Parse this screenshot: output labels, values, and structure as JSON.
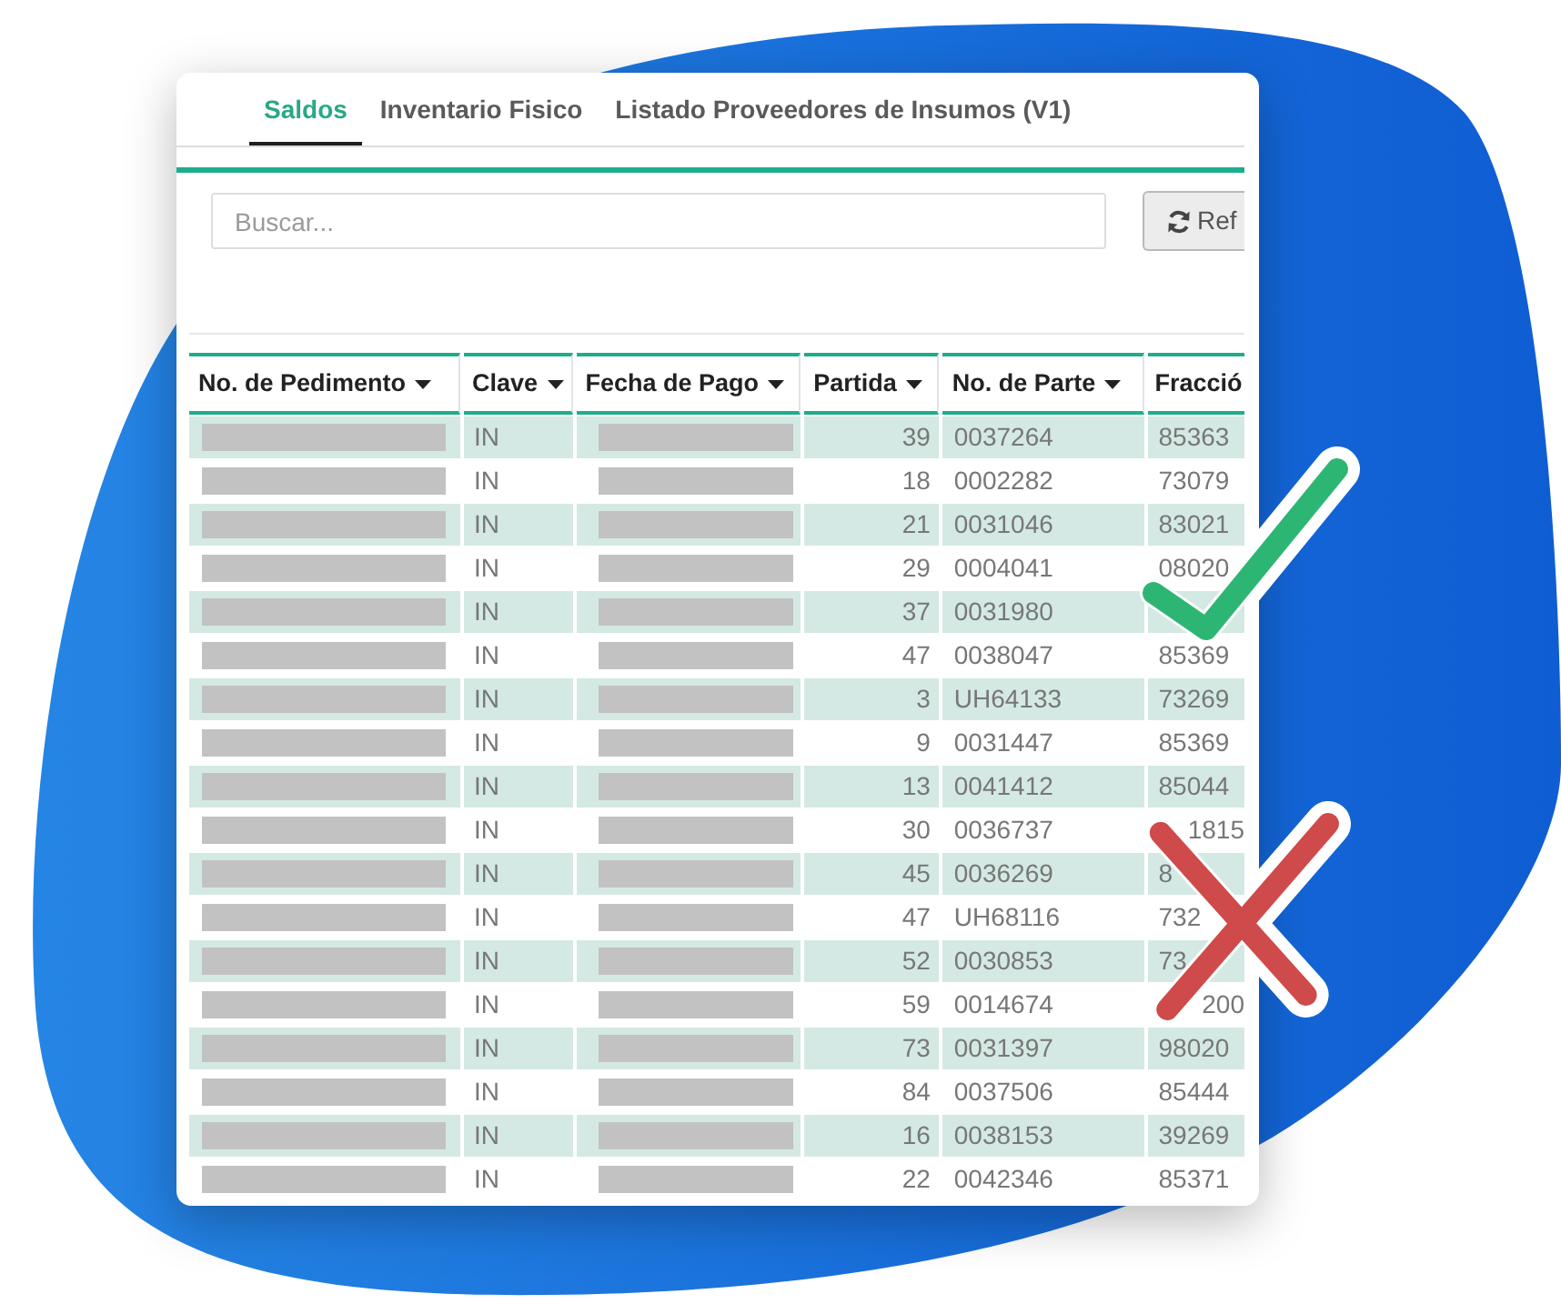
{
  "tabs": [
    {
      "label": "Saldos",
      "selected": true
    },
    {
      "label": "Inventario Fisico",
      "selected": false
    },
    {
      "label": "Listado Proveedores de Insumos (V1)",
      "selected": false
    }
  ],
  "search": {
    "placeholder": "Buscar..."
  },
  "refresh_button": {
    "label": "Ref"
  },
  "table": {
    "columns": [
      {
        "label": "No. de Pedimento",
        "kind": "text"
      },
      {
        "label": "Clave",
        "kind": "text"
      },
      {
        "label": "Fecha de Pago",
        "kind": "text"
      },
      {
        "label": "Partida",
        "kind": "number"
      },
      {
        "label": "No. de Parte",
        "kind": "text"
      },
      {
        "label": "Fracció",
        "kind": "text"
      }
    ],
    "rows": [
      {
        "cells": [
          {
            "redacted": true
          },
          "IN",
          {
            "redacted": true
          },
          "39",
          "0037264",
          "85363"
        ]
      },
      {
        "cells": [
          {
            "redacted": true
          },
          "IN",
          {
            "redacted": true
          },
          "18",
          "0002282",
          "73079"
        ]
      },
      {
        "cells": [
          {
            "redacted": true
          },
          "IN",
          {
            "redacted": true
          },
          "21",
          "0031046",
          "83021"
        ]
      },
      {
        "cells": [
          {
            "redacted": true
          },
          "IN",
          {
            "redacted": true
          },
          "29",
          "0004041",
          "08020"
        ]
      },
      {
        "cells": [
          {
            "redacted": true
          },
          "IN",
          {
            "redacted": true
          },
          "37",
          "0031980"
        ]
      },
      {
        "cells": [
          {
            "redacted": true
          },
          "IN",
          {
            "redacted": true
          },
          "47",
          "0038047",
          "85369"
        ]
      },
      {
        "cells": [
          {
            "redacted": true
          },
          "IN",
          {
            "redacted": true
          },
          "3",
          "UH64133",
          "73269"
        ]
      },
      {
        "cells": [
          {
            "redacted": true
          },
          "IN",
          {
            "redacted": true
          },
          "9",
          "0031447",
          "85369"
        ]
      },
      {
        "cells": [
          {
            "redacted": true
          },
          "IN",
          {
            "redacted": true
          },
          "13",
          "0041412",
          "85044"
        ]
      },
      {
        "cells": [
          {
            "redacted": true
          },
          "IN",
          {
            "redacted": true
          },
          "30",
          "0036737",
          {
            "tail": "1815"
          }
        ]
      },
      {
        "cells": [
          {
            "redacted": true
          },
          "IN",
          {
            "redacted": true
          },
          "45",
          "0036269",
          "8"
        ]
      },
      {
        "cells": [
          {
            "redacted": true
          },
          "IN",
          {
            "redacted": true
          },
          "47",
          "UH68116",
          "732"
        ]
      },
      {
        "cells": [
          {
            "redacted": true
          },
          "IN",
          {
            "redacted": true
          },
          "52",
          "0030853",
          "73"
        ]
      },
      {
        "cells": [
          {
            "redacted": true
          },
          "IN",
          {
            "redacted": true
          },
          "59",
          "0014674",
          {
            "tail": "200"
          }
        ]
      },
      {
        "cells": [
          {
            "redacted": true
          },
          "IN",
          {
            "redacted": true
          },
          "73",
          "0031397",
          "98020"
        ]
      },
      {
        "cells": [
          {
            "redacted": true
          },
          "IN",
          {
            "redacted": true
          },
          "84",
          "0037506",
          "85444"
        ]
      },
      {
        "cells": [
          {
            "redacted": true
          },
          "IN",
          {
            "redacted": true
          },
          "16",
          "0038153",
          "39269"
        ]
      },
      {
        "cells": [
          {
            "redacted": true
          },
          "IN",
          {
            "redacted": true
          },
          "22",
          "0042346",
          "85371"
        ]
      }
    ]
  }
}
